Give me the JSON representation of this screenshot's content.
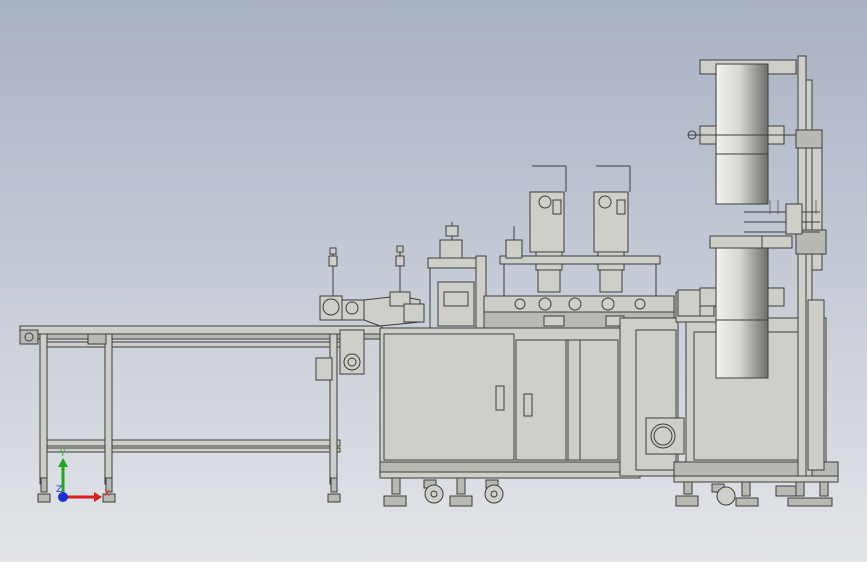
{
  "viewport": {
    "background_top": "#a9b2c3",
    "background_bottom": "#e3e5e9"
  },
  "machine": {
    "body_color": "#cfcfc9",
    "outline_color": "#3c3c3c",
    "roll_color": "#8a8a84"
  },
  "triad": {
    "x_label": "X",
    "y_label": "Y",
    "z_label": "Z",
    "x_color": "#d62020",
    "y_color": "#1ea81e",
    "z_color": "#1a2fd6"
  }
}
